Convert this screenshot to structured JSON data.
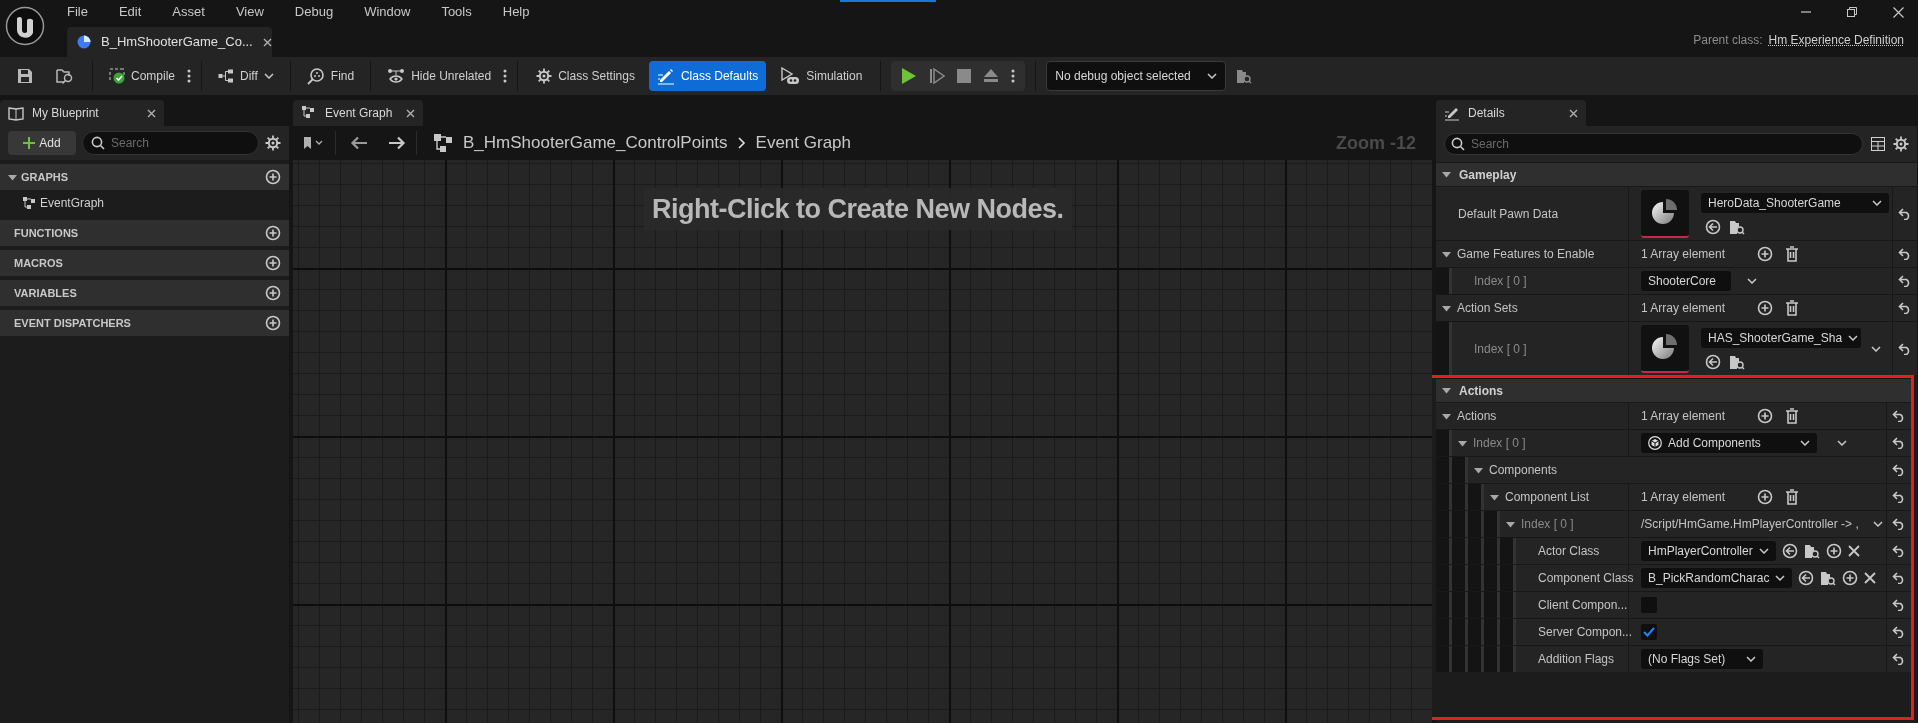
{
  "menu": [
    "File",
    "Edit",
    "Asset",
    "View",
    "Debug",
    "Window",
    "Tools",
    "Help"
  ],
  "document_tab": {
    "title": "B_HmShooterGame_Co..."
  },
  "parent_class": {
    "label": "Parent class:",
    "value": "Hm Experience Definition"
  },
  "toolbar": {
    "tools": [
      {
        "label": "Compile"
      },
      {
        "label": "Diff"
      },
      {
        "label": "Find"
      },
      {
        "label": "Hide Unrelated"
      }
    ],
    "modes": [
      {
        "label": "Class Settings",
        "selected": false
      },
      {
        "label": "Class Defaults",
        "selected": true
      },
      {
        "label": "Simulation",
        "selected": false
      }
    ],
    "debug_object": "No debug object selected"
  },
  "my_blueprint": {
    "tab": "My Blueprint",
    "add_button": "Add",
    "search": {
      "placeholder": "Search"
    },
    "sections": [
      {
        "label": "GRAPHS",
        "items": [
          "EventGraph"
        ]
      },
      {
        "label": "FUNCTIONS"
      },
      {
        "label": "MACROS"
      },
      {
        "label": "VARIABLES"
      },
      {
        "label": "EVENT DISPATCHERS"
      }
    ]
  },
  "graph": {
    "tab": "Event Graph",
    "breadcrumb": [
      "B_HmShooterGame_ControlPoints",
      "Event Graph"
    ],
    "zoom": "Zoom -12",
    "hint": "Right-Click to Create New Nodes."
  },
  "details": {
    "tab": "Details",
    "search": {
      "placeholder": "Search"
    },
    "categories": [
      {
        "label": "Gameplay",
        "expanded": true,
        "rows": [
          {
            "label": "Default Pawn Data",
            "kind": "asset",
            "value": "HeroData_ShooterGame"
          },
          {
            "label": "Game Features to Enable",
            "kind": "array",
            "value": "1 Array element",
            "expanded": true,
            "children": [
              {
                "label": "Index [ 0 ]",
                "kind": "combo",
                "value": "ShooterCore"
              }
            ]
          },
          {
            "label": "Action Sets",
            "kind": "array",
            "value": "1 Array element",
            "expanded": true,
            "children": [
              {
                "label": "Index [ 0 ]",
                "kind": "asset",
                "value": "HAS_ShooterGame_Sha"
              }
            ]
          }
        ]
      },
      {
        "label": "Actions",
        "expanded": true,
        "highlighted": true,
        "rows": [
          {
            "label": "Actions",
            "kind": "array",
            "value": "1 Array element",
            "expanded": true,
            "children": [
              {
                "label": "Index [ 0 ]",
                "kind": "instanced",
                "value": "Add Components",
                "expanded": true,
                "children": [
                  {
                    "label": "Components",
                    "kind": "group",
                    "expanded": true,
                    "children": [
                      {
                        "label": "Component List",
                        "kind": "array",
                        "value": "1 Array element",
                        "expanded": true,
                        "children": [
                          {
                            "label": "Index [ 0 ]",
                            "kind": "text",
                            "value": "/Script/HmGame.HmPlayerController -> ,",
                            "expanded": true,
                            "children": [
                              {
                                "label": "Actor Class",
                                "kind": "class",
                                "value": "HmPlayerController"
                              },
                              {
                                "label": "Component Class",
                                "kind": "class",
                                "value": "B_PickRandomCharac"
                              },
                              {
                                "label": "Client Compon...",
                                "kind": "checkbox",
                                "checked": false
                              },
                              {
                                "label": "Server Compon...",
                                "kind": "checkbox",
                                "checked": true
                              },
                              {
                                "label": "Addition Flags",
                                "kind": "combo",
                                "value": "(No Flags Set)"
                              }
                            ]
                          }
                        ]
                      }
                    ]
                  }
                ]
              }
            ]
          }
        ]
      }
    ]
  }
}
